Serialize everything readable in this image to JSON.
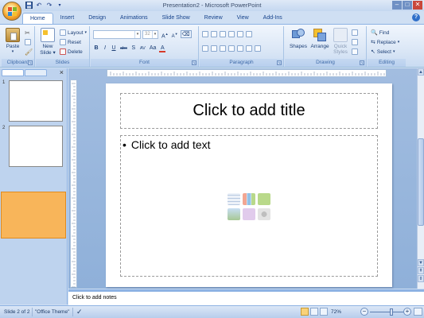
{
  "window": {
    "title": "Presentation2 - Microsoft PowerPoint",
    "controls": [
      "–",
      "□",
      "✕"
    ]
  },
  "quick_access": [
    "save",
    "undo",
    "redo",
    "customize"
  ],
  "ribbon": {
    "tabs": [
      "Home",
      "Insert",
      "Design",
      "Animations",
      "Slide Show",
      "Review",
      "View",
      "Add-Ins"
    ],
    "active_tab": "Home",
    "groups": {
      "clipboard": {
        "label": "Clipboard",
        "paste": "Paste"
      },
      "slides": {
        "label": "Slides",
        "new_slide_line1": "New",
        "new_slide_line2": "Slide",
        "layout": "Layout",
        "reset": "Reset",
        "delete": "Delete"
      },
      "font": {
        "label": "Font",
        "font_size": "32",
        "grow": "A",
        "shrink": "A",
        "bold": "B",
        "italic": "I",
        "underline": "U",
        "strike": "abc",
        "shadow": "S",
        "spacing": "AV",
        "case": "Aa",
        "color": "A"
      },
      "paragraph": {
        "label": "Paragraph"
      },
      "drawing": {
        "label": "Drawing",
        "shapes": "Shapes",
        "arrange": "Arrange",
        "quick_styles_line1": "Quick",
        "quick_styles_line2": "Styles"
      },
      "editing": {
        "label": "Editing",
        "find": "Find",
        "replace": "Replace",
        "select": "Select"
      }
    }
  },
  "slides_panel": {
    "slides": [
      {
        "number": "1"
      },
      {
        "number": "2",
        "selected": true
      }
    ]
  },
  "slide": {
    "title_placeholder": "Click to add title",
    "body_bullet": "•",
    "body_placeholder": "Click to add text"
  },
  "notes": {
    "placeholder": "Click to add notes"
  },
  "status_bar": {
    "slide_info": "Slide 2 of 2",
    "theme": "\"Office Theme\"",
    "zoom": "72%"
  },
  "colors": {
    "accent": "#f8b55a",
    "ribbon_bg": "#dbe7f6",
    "workspace_bg": "#9fbbe0"
  }
}
